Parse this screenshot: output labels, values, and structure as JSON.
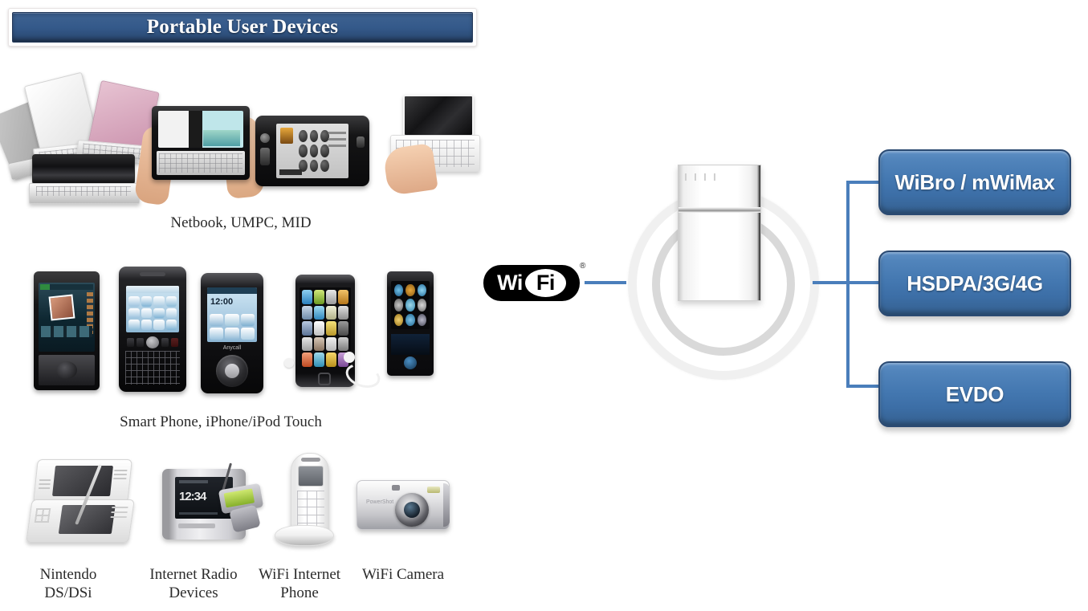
{
  "header": {
    "title": "Portable User Devices"
  },
  "device_groups": [
    {
      "id": "netbook-group",
      "caption": "Netbook, UMPC, MID",
      "devices": [
        {
          "name": "netbook-cluster",
          "label": "Netbook"
        },
        {
          "name": "umpc-handheld",
          "label": "UMPC"
        },
        {
          "name": "mid-tablet",
          "label": "MID"
        },
        {
          "name": "mini-laptop",
          "label": "Mini laptop"
        }
      ]
    },
    {
      "id": "smartphone-group",
      "caption": "Smart Phone, iPhone/iPod Touch",
      "devices": [
        {
          "name": "htc-touch-phone",
          "label": "Touch screen phone"
        },
        {
          "name": "blackberry-phone",
          "label": "BlackBerry"
        },
        {
          "name": "anycall-phone",
          "label": "Anycall"
        },
        {
          "name": "ipod-touch",
          "label": "iPod Touch"
        },
        {
          "name": "media-player",
          "label": "Portable media player"
        }
      ]
    },
    {
      "id": "other-devices-group",
      "devices": [
        {
          "name": "nintendo-ds",
          "caption": "Nintendo\nDS/DSi"
        },
        {
          "name": "internet-radio",
          "caption": "Internet Radio\nDevices"
        },
        {
          "name": "wifi-phone",
          "caption": "WiFi Internet\nPhone"
        },
        {
          "name": "wifi-camera",
          "caption": "WiFi Camera"
        }
      ]
    }
  ],
  "wifi": {
    "brand_wi": "Wi",
    "brand_fi": "Fi",
    "registered_mark": "®"
  },
  "router": {
    "name": "wireless-router"
  },
  "networks": [
    {
      "label": "WiBro / mWiMax"
    },
    {
      "label": "HSDPA/3G/4G"
    },
    {
      "label": "EVDO"
    }
  ],
  "colors": {
    "box_blue": "#4377b0",
    "box_border": "#2b4a72",
    "connector_blue": "#4a7ebb",
    "title_blue": "#34598a",
    "background": "#ffffff",
    "ring_gray": "#d9d9d9"
  }
}
